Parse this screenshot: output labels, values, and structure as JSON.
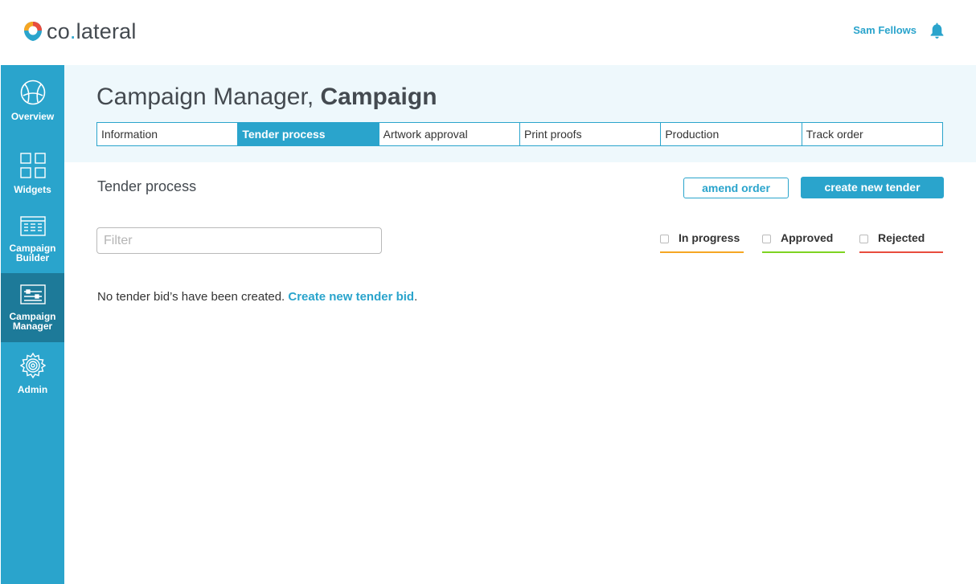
{
  "brand": {
    "name_part1": "co",
    "name_dot": ".",
    "name_part2": "lateral"
  },
  "user": {
    "name": "Sam Fellows"
  },
  "sidebar": {
    "items": [
      {
        "label": "Overview",
        "icon": "globe-icon"
      },
      {
        "label": "Widgets",
        "icon": "grid-icon"
      },
      {
        "label": "Campaign Builder",
        "icon": "calendar-icon"
      },
      {
        "label": "Campaign Manager",
        "icon": "sliders-icon",
        "active": true
      },
      {
        "label": "Admin",
        "icon": "gear-icon"
      }
    ]
  },
  "header": {
    "title_prefix": "Campaign Manager, ",
    "title_bold": "Campaign"
  },
  "tabs": [
    {
      "label": "Information"
    },
    {
      "label": "Tender process",
      "active": true
    },
    {
      "label": "Artwork approval"
    },
    {
      "label": "Print proofs"
    },
    {
      "label": "Production"
    },
    {
      "label": "Track order"
    }
  ],
  "section": {
    "title": "Tender process",
    "amend_label": "amend order",
    "create_label": "create new tender"
  },
  "filter": {
    "placeholder": "Filter",
    "value": ""
  },
  "statuses": [
    {
      "label": "In progress",
      "color": "#f5a623"
    },
    {
      "label": "Approved",
      "color": "#7ed321"
    },
    {
      "label": "Rejected",
      "color": "#e84c3d"
    }
  ],
  "empty": {
    "text": "No tender bid’s have been created. ",
    "link": "Create new tender bid",
    "suffix": "."
  },
  "colors": {
    "accent": "#2aa4cc",
    "accent_dark": "#1d7a99",
    "header_bg": "#eef8fc"
  }
}
